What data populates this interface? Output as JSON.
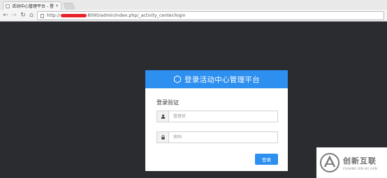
{
  "browser": {
    "tab_title": "活动中心管理平台 - 登录",
    "tab_close": "×",
    "url_prefix": "http://",
    "url_suffix": "8090/admin/index.php/_activity_center/login",
    "nav": {
      "back": "←",
      "forward": "→",
      "reload": "↻",
      "home": "⌂"
    }
  },
  "card": {
    "header_title": "登录活动中心管理平台",
    "section_title": "登录验证",
    "username_placeholder": "管理员",
    "password_placeholder": "密码",
    "login_button": "登录",
    "accent_color": "#2d8ff0"
  },
  "watermark": {
    "name": "创新互联",
    "sub": "CHUANG XIN HU LIAN"
  },
  "colors": {
    "page_background": "#2b2c30",
    "accent": "#2d8ff0",
    "redaction": "#e8232a"
  }
}
